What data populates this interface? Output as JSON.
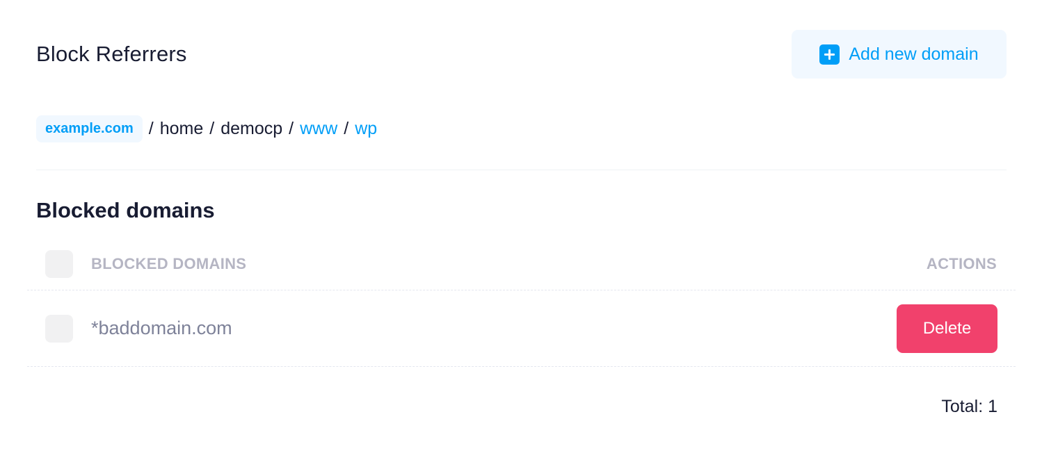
{
  "header": {
    "title": "Block Referrers",
    "add_button_label": "Add new domain"
  },
  "breadcrumb": {
    "domain": "example.com",
    "separator": "/",
    "segments": [
      {
        "label": "home",
        "link": false
      },
      {
        "label": "democp",
        "link": false
      },
      {
        "label": "www",
        "link": true
      },
      {
        "label": "wp",
        "link": true
      }
    ]
  },
  "section": {
    "title": "Blocked domains"
  },
  "table": {
    "columns": {
      "domains": "BLOCKED DOMAINS",
      "actions": "ACTIONS"
    },
    "rows": [
      {
        "domain": "*baddomain.com",
        "action_label": "Delete"
      }
    ]
  },
  "footer": {
    "total_text": "Total: 1"
  },
  "colors": {
    "primary": "#009ef7",
    "primary_light": "#f1f8ff",
    "danger": "#f1416c",
    "text_dark": "#181c32",
    "text_muted": "#b5b5c3"
  },
  "icons": {
    "add_button": "plus-square-icon"
  }
}
